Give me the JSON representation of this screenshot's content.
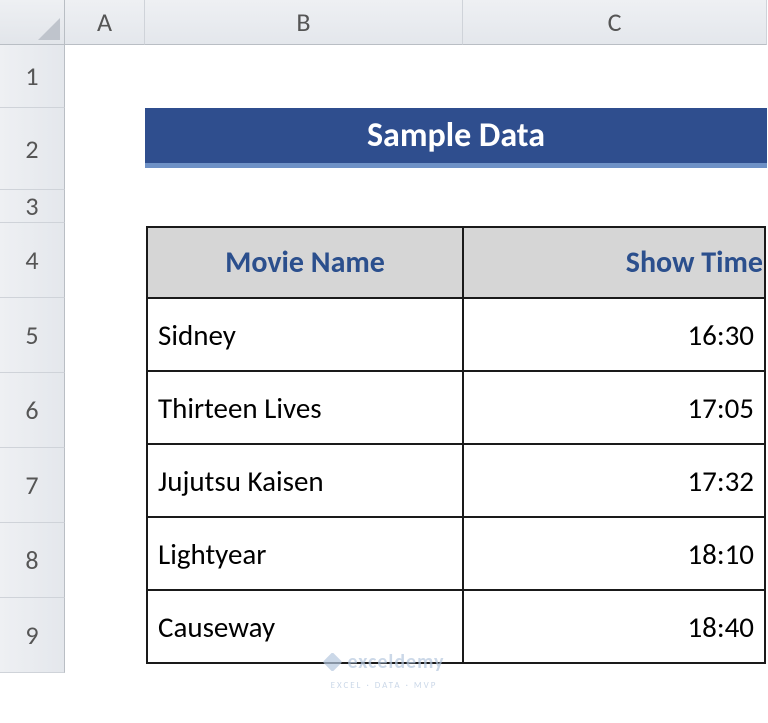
{
  "columns": {
    "a": "A",
    "b": "B",
    "c": "C"
  },
  "rows": {
    "r1": "1",
    "r2": "2",
    "r3": "3",
    "r4": "4",
    "r5": "5",
    "r6": "6",
    "r7": "7",
    "r8": "8",
    "r9": "9"
  },
  "title": "Sample Data",
  "headers": {
    "movie": "Movie Name",
    "time": "Show Time"
  },
  "data": [
    {
      "movie": "Sidney",
      "time": "16:30"
    },
    {
      "movie": "Thirteen Lives",
      "time": "17:05"
    },
    {
      "movie": "Jujutsu Kaisen",
      "time": "17:32"
    },
    {
      "movie": "Lightyear",
      "time": "18:10"
    },
    {
      "movie": "Causeway",
      "time": "18:40"
    }
  ],
  "watermark": {
    "main": "exceldemy",
    "sub": "EXCEL · DATA · MVP"
  }
}
